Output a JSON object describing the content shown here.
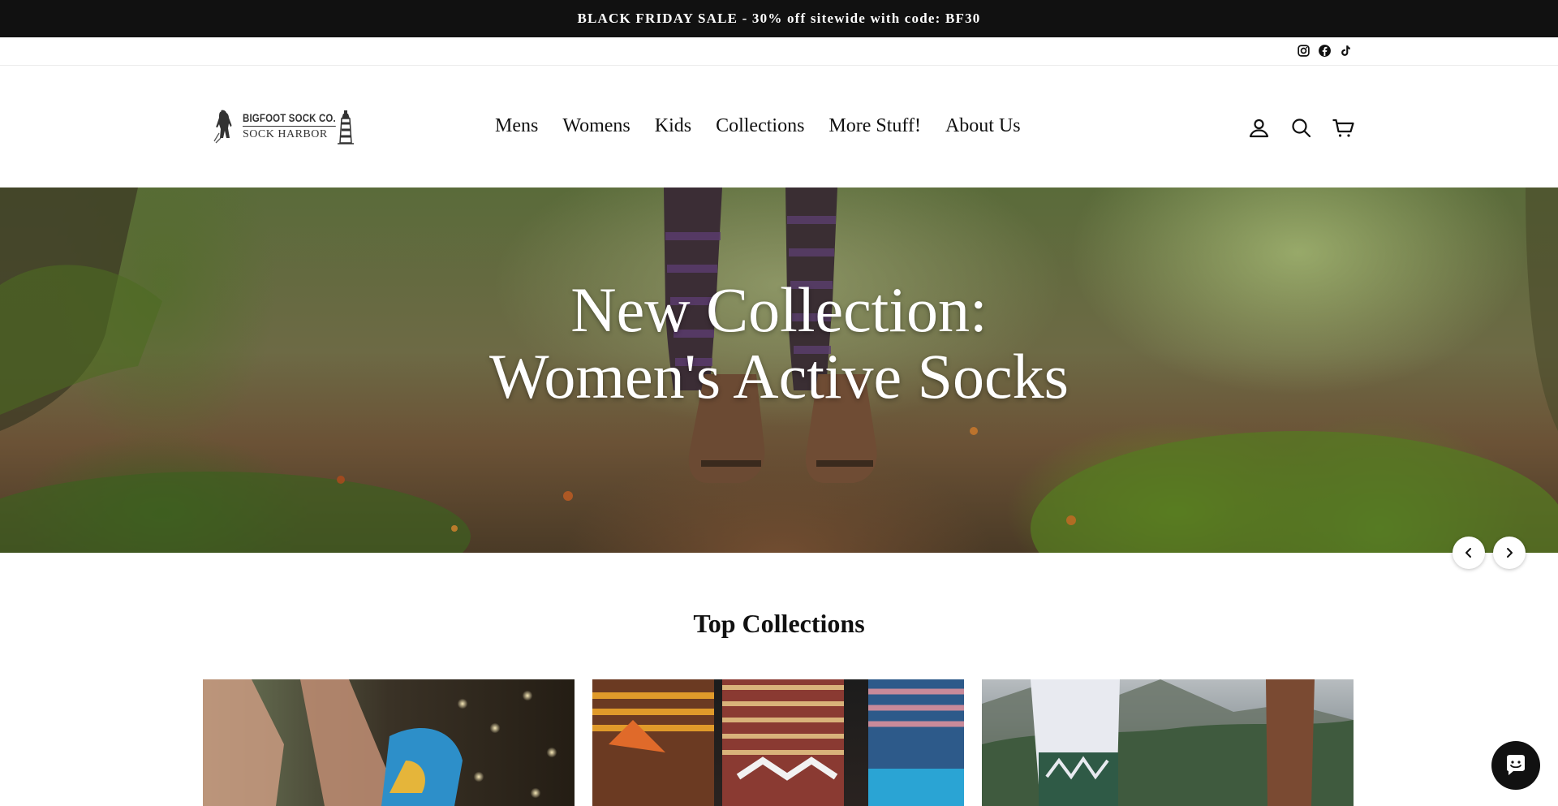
{
  "announcement": {
    "text": "BLACK FRIDAY SALE - 30% off sitewide with code: BF30"
  },
  "social": {
    "icons": [
      "instagram-icon",
      "facebook-icon",
      "tiktok-icon"
    ]
  },
  "logo": {
    "line1": "BIGFOOT SOCK CO.",
    "line2": "SOCK HARBOR"
  },
  "nav": {
    "items": [
      {
        "label": "Mens"
      },
      {
        "label": "Womens"
      },
      {
        "label": "Kids"
      },
      {
        "label": "Collections"
      },
      {
        "label": "More Stuff!"
      },
      {
        "label": "About Us"
      }
    ]
  },
  "header_icons": [
    "account-icon",
    "search-icon",
    "cart-icon"
  ],
  "hero": {
    "title_line1": "New Collection:",
    "title_line2": "Women's Active Socks"
  },
  "slider": {
    "prev_icon": "chevron-left-icon",
    "next_icon": "chevron-right-icon"
  },
  "collections": {
    "title": "Top Collections"
  },
  "colors": {
    "announcement_bg": "#111111",
    "text": "#111111",
    "chat_bg": "#111111"
  }
}
